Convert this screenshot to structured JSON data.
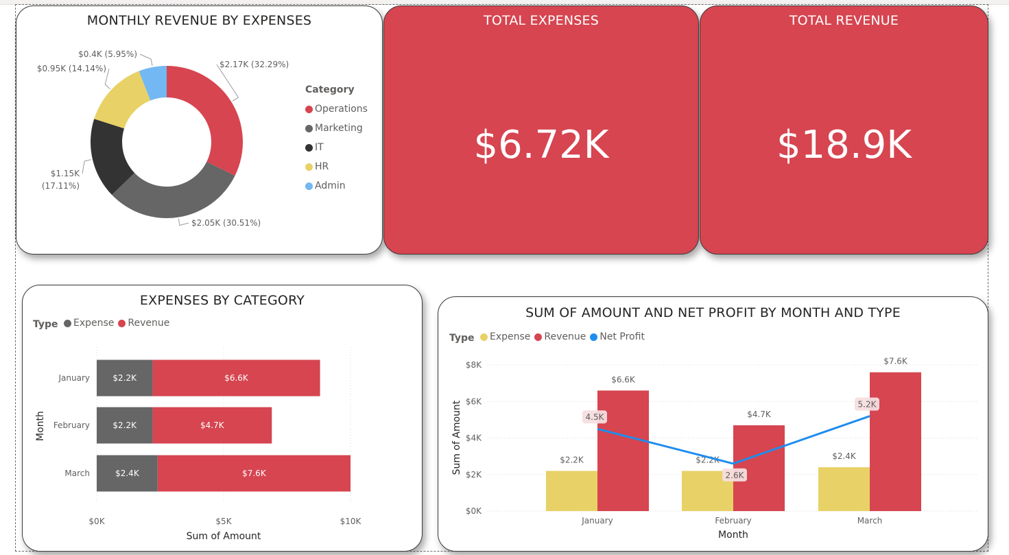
{
  "donut_card": {
    "title": "MONTHLY REVENUE BY EXPENSES",
    "legend_title": "Category"
  },
  "expenses_card": {
    "title": "TOTAL EXPENSES",
    "value": "$6.72K"
  },
  "revenue_card": {
    "title": "TOTAL REVENUE",
    "value": "$18.9K"
  },
  "bar_card": {
    "title": "EXPENSES BY CATEGORY",
    "legend_title": "Type"
  },
  "combo_card": {
    "title": "SUM OF AMOUNT AND NET PROFIT BY MONTH AND TYPE",
    "legend_title": "Type"
  },
  "colors": {
    "operations": "#d64550",
    "marketing": "#666666",
    "it": "#333333",
    "hr": "#e8d166",
    "admin": "#73b8f2",
    "expense_bar": "#666666",
    "revenue_bar": "#d64550",
    "expense_col": "#e8d166",
    "net_profit": "#1f8ded"
  },
  "chart_data": [
    {
      "type": "pie",
      "variant": "donut",
      "title": "MONTHLY REVENUE BY EXPENSES",
      "legend_title": "Category",
      "legend_position": "right",
      "slices": [
        {
          "name": "Operations",
          "value": 2.17,
          "percent": 32.29,
          "label": "$2.17K (32.29%)",
          "color": "#d64550"
        },
        {
          "name": "Marketing",
          "value": 2.05,
          "percent": 30.51,
          "label": "$2.05K (30.51%)",
          "color": "#666666"
        },
        {
          "name": "IT",
          "value": 1.15,
          "percent": 17.11,
          "label_line1": "$1.15K",
          "label_line2": "(17.11%)",
          "color": "#333333"
        },
        {
          "name": "HR",
          "value": 0.95,
          "percent": 14.14,
          "label": "$0.95K (14.14%)",
          "color": "#e8d166"
        },
        {
          "name": "Admin",
          "value": 0.4,
          "percent": 5.95,
          "label": "$0.4K (5.95%)",
          "color": "#73b8f2"
        }
      ]
    },
    {
      "type": "bar",
      "orientation": "horizontal",
      "stacked": true,
      "title": "EXPENSES BY CATEGORY",
      "legend_title": "Type",
      "legend_position": "top-left",
      "categories": [
        "January",
        "February",
        "March"
      ],
      "series": [
        {
          "name": "Expense",
          "values": [
            2.2,
            2.2,
            2.4
          ],
          "labels": [
            "$2.2K",
            "$2.2K",
            "$2.4K"
          ],
          "color": "#666666"
        },
        {
          "name": "Revenue",
          "values": [
            6.6,
            4.7,
            7.6
          ],
          "labels": [
            "$6.6K",
            "$4.7K",
            "$7.6K"
          ],
          "color": "#d64550"
        }
      ],
      "xlabel": "Sum of Amount",
      "ylabel": "Month",
      "xlim": [
        0,
        10
      ],
      "xticks": [
        0,
        5,
        10
      ],
      "xtick_labels": [
        "$0K",
        "$5K",
        "$10K"
      ],
      "grid": true
    },
    {
      "type": "bar",
      "variant": "clustered column + line",
      "title": "SUM OF AMOUNT AND NET PROFIT BY MONTH AND TYPE",
      "legend_title": "Type",
      "legend_position": "top-left",
      "categories": [
        "January",
        "February",
        "March"
      ],
      "series": [
        {
          "name": "Expense",
          "kind": "column",
          "values": [
            2.2,
            2.2,
            2.4
          ],
          "labels": [
            "$2.2K",
            "$2.2K",
            "$2.4K"
          ],
          "color": "#e8d166"
        },
        {
          "name": "Revenue",
          "kind": "column",
          "values": [
            6.6,
            4.7,
            7.6
          ],
          "labels": [
            "$6.6K",
            "$4.7K",
            "$7.6K"
          ],
          "color": "#d64550"
        },
        {
          "name": "Net Profit",
          "kind": "line",
          "values": [
            4.5,
            2.6,
            5.2
          ],
          "labels": [
            "4.5K",
            "2.6K",
            "5.2K"
          ],
          "color": "#1f8ded"
        }
      ],
      "xlabel": "Month",
      "ylabel": "Sum of Amount",
      "ylim": [
        0,
        8
      ],
      "yticks": [
        0,
        2,
        4,
        6,
        8
      ],
      "ytick_labels": [
        "$0K",
        "$2K",
        "$4K",
        "$6K",
        "$8K"
      ],
      "grid": true
    }
  ]
}
